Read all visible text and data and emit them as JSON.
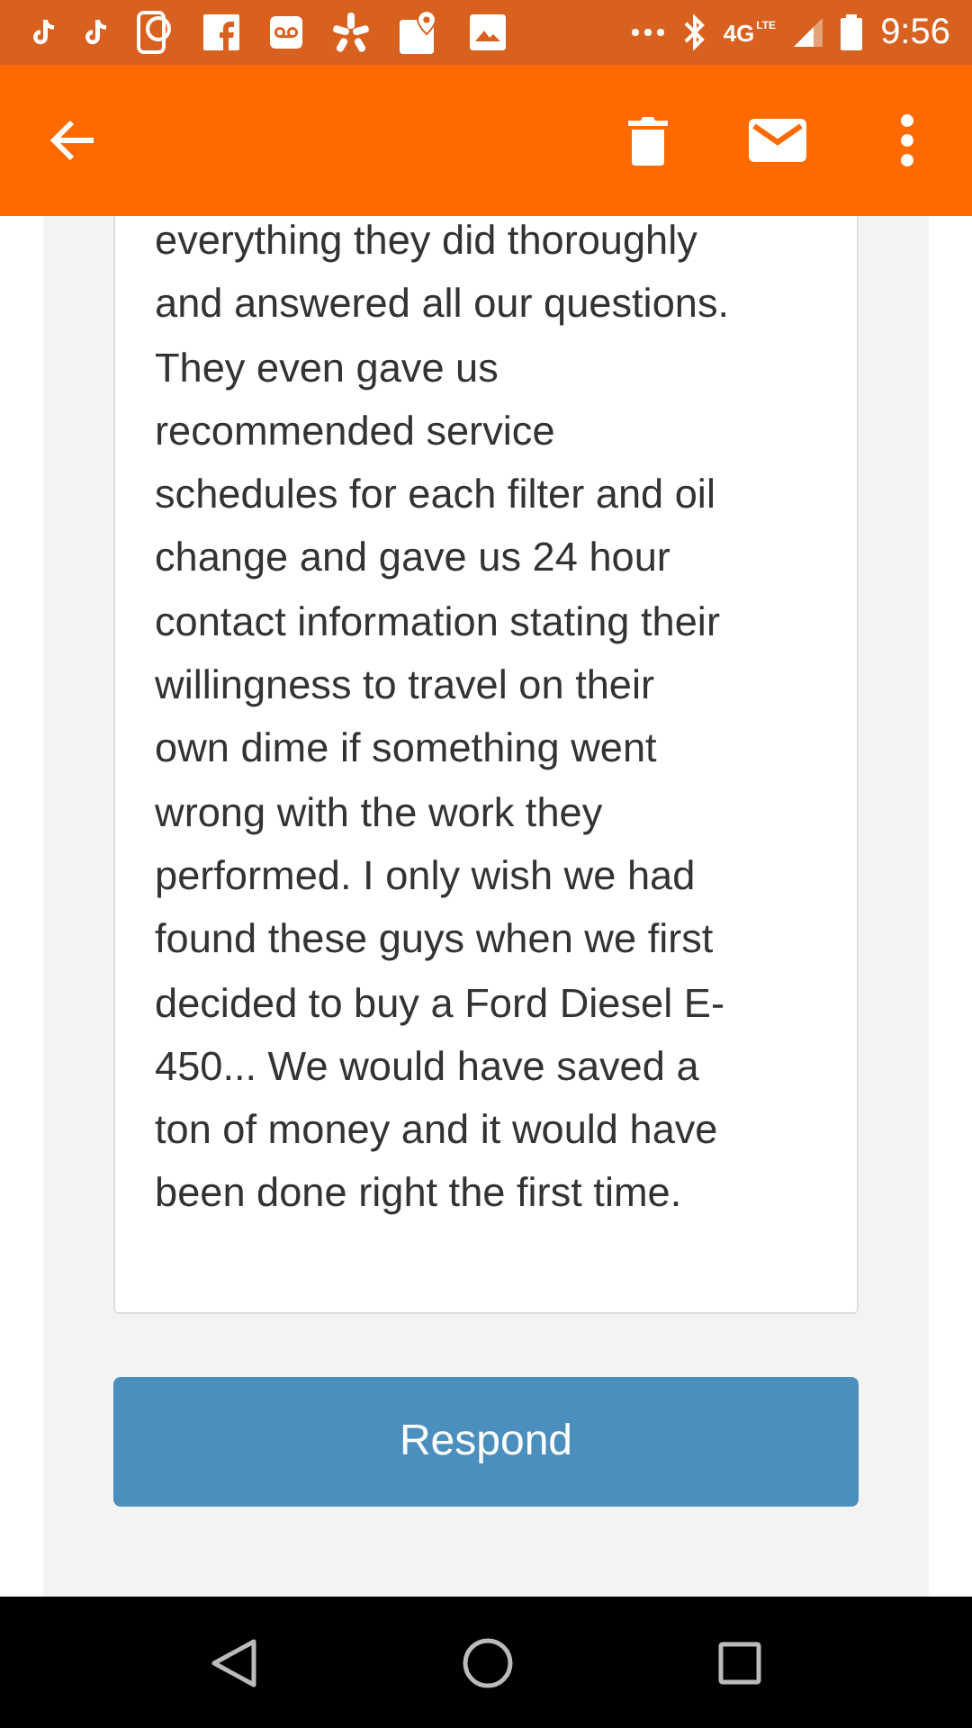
{
  "status_bar": {
    "network": "4G",
    "network_sub": "LTE",
    "time": "9:56"
  },
  "review": {
    "lines": [
      "everything they did thoroughly",
      "and answered all our questions.",
      "They even gave us",
      "recommended service",
      "schedules for each filter and oil",
      "change and gave us 24 hour",
      "contact information stating their",
      "willingness to travel on their",
      "own dime if something went",
      "wrong with the work they",
      "performed. I only wish we had",
      "found these guys when we first",
      "decided to buy a Ford Diesel E-",
      "450... We would have saved a",
      "ton of money and it would have",
      "been done right the first time."
    ]
  },
  "button": {
    "label": "Respond"
  }
}
